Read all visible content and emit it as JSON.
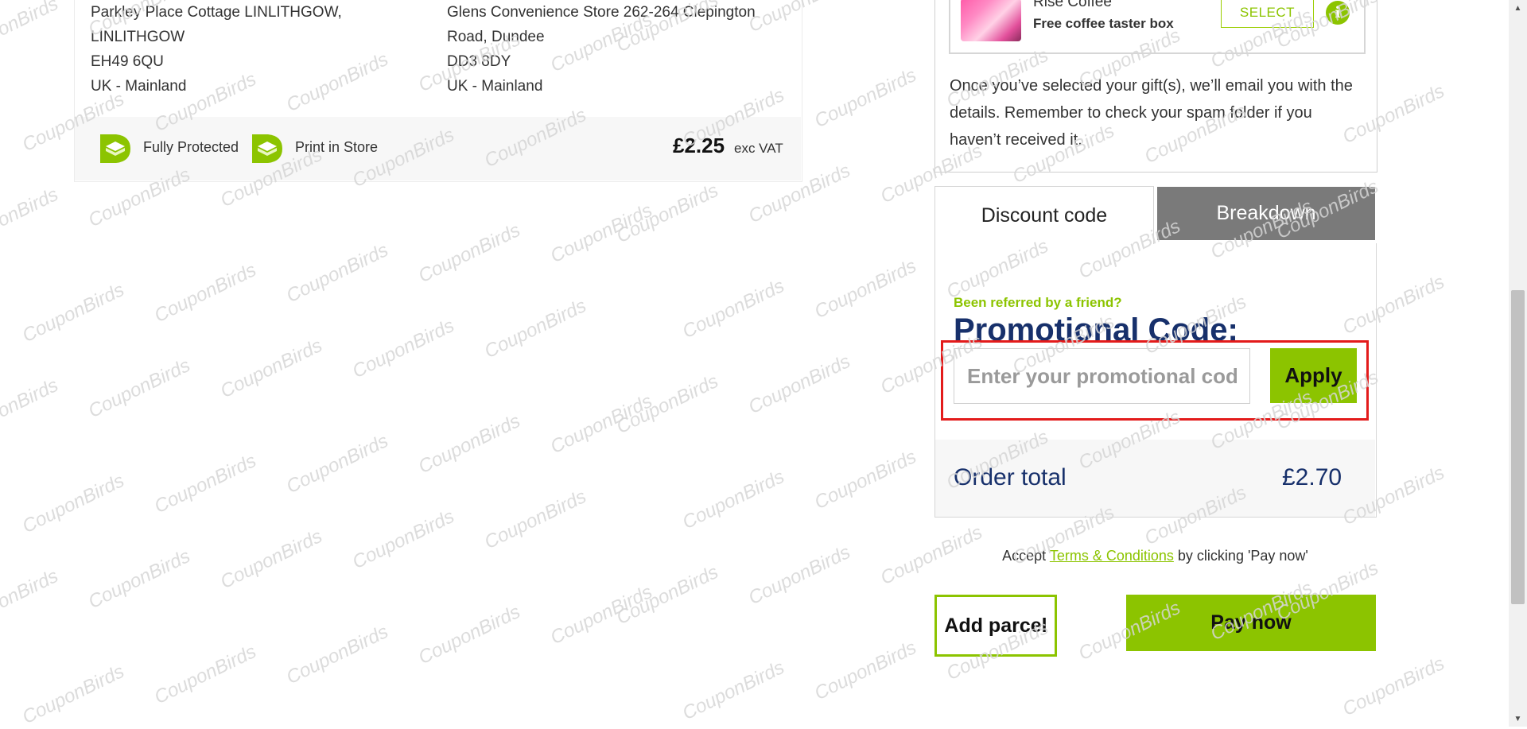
{
  "parcel": {
    "sender_address": [
      "Parkley Place Cottage LINLITHGOW,",
      "LINLITHGOW",
      "EH49 6QU",
      "UK - Mainland"
    ],
    "dropoff_address": [
      "Glens Convenience Store 262-264 Clepington",
      "Road, Dundee",
      "DD3 8DY",
      "UK - Mainland"
    ],
    "features": [
      {
        "label": "Fully Protected",
        "icon": "shield-check-icon"
      },
      {
        "label": "Print in Store",
        "icon": "printer-icon"
      }
    ],
    "price": "£2.25",
    "price_suffix": "exc VAT"
  },
  "gift": {
    "brand": "Rise Coffee",
    "title": "Free coffee taster box",
    "select_label": "SELECT",
    "info_icon": "info-icon",
    "note": "Once you’ve selected your gift(s), we’ll email you with the details. Remember to check your spam folder if you haven’t received it."
  },
  "tabs": [
    {
      "label": "Discount code",
      "active": true
    },
    {
      "label": "Breakdown",
      "active": false
    }
  ],
  "promo": {
    "referred_text": "Been referred by a friend?",
    "title": "Promotional Code:",
    "input_placeholder": "Enter your promotional code",
    "input_value": "",
    "apply_label": "Apply"
  },
  "order": {
    "total_label": "Order total",
    "total_value": "£2.70"
  },
  "terms": {
    "prefix": "Accept",
    "link": "Terms & Conditions",
    "suffix": "by clicking 'Pay now'"
  },
  "actions": {
    "add_parcel": "Add parcel",
    "pay_now": "Pay now"
  },
  "watermark": "CouponBirds",
  "colors": {
    "accent_green": "#8cc400",
    "navy": "#17306b",
    "tab_inactive": "#7a7a7a",
    "highlight_red": "#e31b1b"
  }
}
